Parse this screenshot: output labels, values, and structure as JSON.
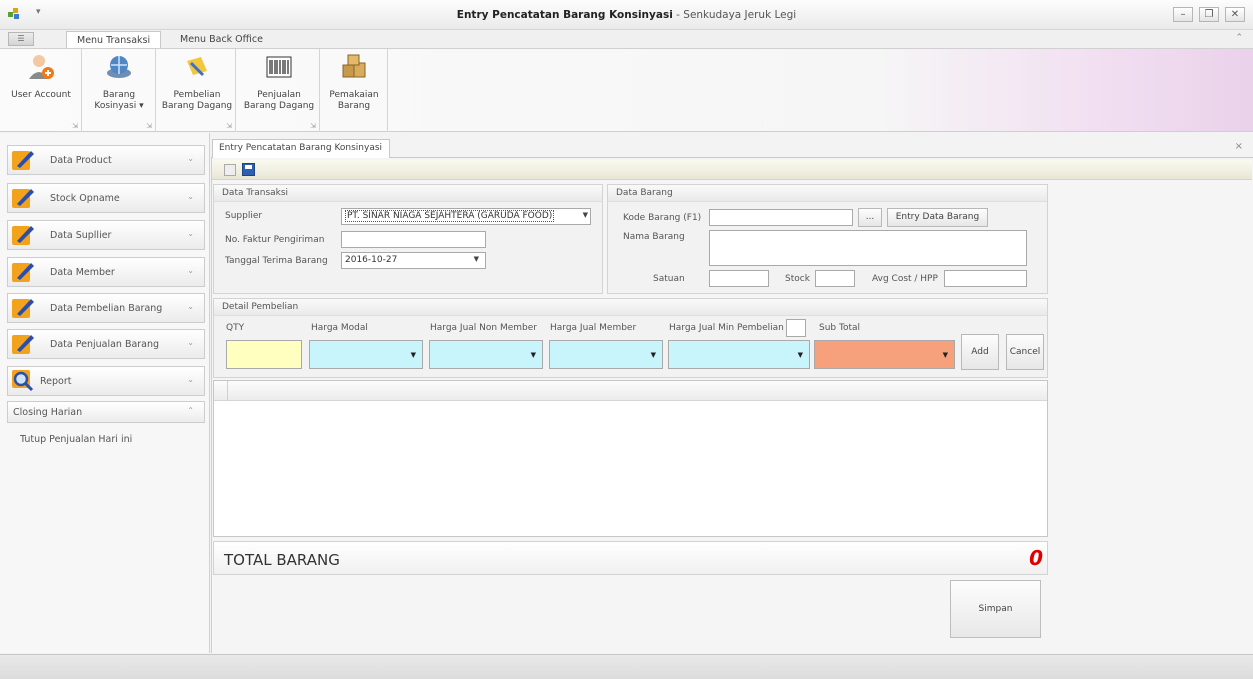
{
  "window": {
    "title_strong": "Entry Pencatatan Barang Konsinyasi",
    "title_rest": " - Senkudaya Jeruk Legi",
    "controls": [
      "–",
      "❐",
      "✕"
    ]
  },
  "ribbon": {
    "file_tab": "☰",
    "tabs": [
      "Menu Transaksi",
      "Menu Back Office"
    ],
    "groups": [
      {
        "label_1": "User Account",
        "label_2": "",
        "icon": "user-add-icon"
      },
      {
        "label_1": "Barang",
        "label_2": "Kosinyasi ▾",
        "icon": "globe-icon"
      },
      {
        "label_1": "Pembelian",
        "label_2": "Barang Dagang",
        "icon": "purchase-icon"
      },
      {
        "label_1": "Penjualan",
        "label_2": "Barang Dagang",
        "icon": "barcode-icon"
      },
      {
        "label_1": "Pemakaian",
        "label_2": "Barang",
        "icon": "boxes-icon"
      }
    ]
  },
  "nav": {
    "items": [
      {
        "label": "Data Product",
        "icon": "pencil-icon"
      },
      {
        "label": "Stock Opname",
        "icon": "pencil-icon"
      },
      {
        "label": "Data Supllier",
        "icon": "pencil-icon"
      },
      {
        "label": "Data Member",
        "icon": "pencil-icon"
      },
      {
        "label": "Data Pembelian Barang",
        "icon": "pencil-icon"
      },
      {
        "label": "Data Penjualan Barang",
        "icon": "pencil-icon"
      },
      {
        "label": "Report",
        "icon": "magnifier-icon"
      }
    ],
    "chevron_down": "⌄",
    "chevron_up": "⌃",
    "closing": {
      "label": "Closing Harian",
      "sub_item": "Tutup Penjualan Hari ini"
    }
  },
  "document": {
    "tab_label": "Entry Pencatatan Barang Konsinyasi",
    "close": "×"
  },
  "transaksi": {
    "header": "Data Transaksi",
    "supplier_label": "Supplier",
    "supplier_value": "PT. SINAR NIAGA SEJAHTERA (GARUDA FOOD)",
    "faktur_label": "No. Faktur Pengiriman",
    "faktur_value": "",
    "tanggal_label": "Tanggal Terima Barang",
    "tanggal_value": "2016-10-27"
  },
  "barang": {
    "header": "Data Barang",
    "kode_label": "Kode Barang (F1)",
    "kode_value": "",
    "browse": "...",
    "entry_button": "Entry Data Barang",
    "nama_label": "Nama Barang",
    "satuan_label": "Satuan",
    "stock_label": "Stock",
    "avg_label": "Avg Cost / HPP"
  },
  "detail": {
    "header": "Detail Pembelian",
    "qty_label": "QTY",
    "harga_modal_label": "Harga Modal",
    "harga_non_member_label": "Harga Jual Non Member",
    "harga_member_label": "Harga Jual Member",
    "harga_min_label": "Harga Jual Min Pembelian",
    "subtotal_label": "Sub Total",
    "add_button": "Add",
    "cancel_button": "Cancel",
    "colors": {
      "qty": "#ffffc0",
      "price": "#c8f4fb",
      "subtotal": "#f7a07c"
    }
  },
  "totals": {
    "label": "TOTAL BARANG",
    "value": "0"
  },
  "actions": {
    "simpan": "Simpan"
  }
}
